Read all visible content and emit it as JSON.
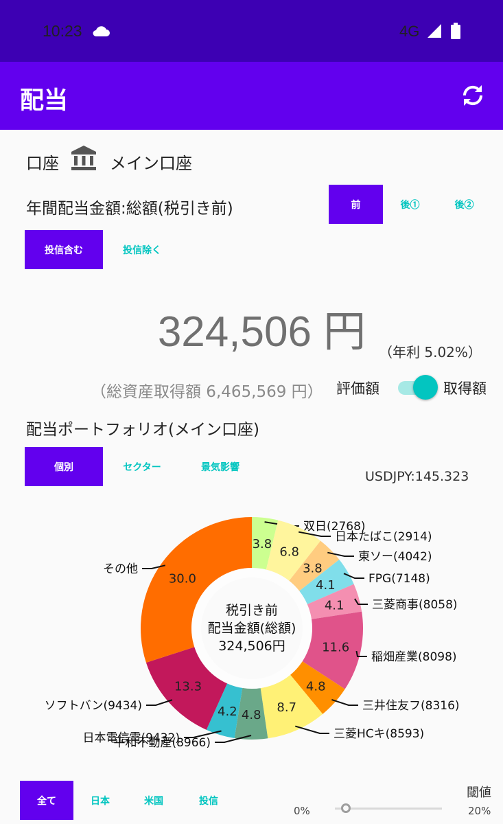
{
  "status_bar": {
    "time": "10:23",
    "network": "4G"
  },
  "app_bar": {
    "title": "配当"
  },
  "account": {
    "label": "口座",
    "name": "メイン口座"
  },
  "annual": {
    "title": "年間配当金額:総額(税引き前)",
    "tax_tabs": [
      "前",
      "後①",
      "後②"
    ],
    "fund_tabs": [
      "投信含む",
      "投信除く"
    ]
  },
  "summary": {
    "total": "324,506 円",
    "yield": "（年利 5.02%）",
    "acquisition": "（総資産取得額 6,465,569 円）",
    "toggle_left": "評価額",
    "toggle_right": "取得額",
    "toggle_on": true
  },
  "portfolio": {
    "title": "配当ポートフォリオ(メイン口座)",
    "tabs": [
      "個別",
      "セクター",
      "景気影響"
    ],
    "usdjpy": "USDJPY:145.323"
  },
  "chart_data": {
    "type": "pie",
    "center_text": [
      "税引き前",
      "配当金額(総額)",
      "324,506円"
    ],
    "slices": [
      {
        "label": "双日(2768)",
        "value": 3.8,
        "color": "#ccff90"
      },
      {
        "label": "日本たばこ(2914)",
        "value": 6.8,
        "color": "#fff59d"
      },
      {
        "label": "東ソー(4042)",
        "value": 3.8,
        "color": "#ffcc80"
      },
      {
        "label": "FPG(7148)",
        "value": 4.1,
        "color": "#80deea"
      },
      {
        "label": "三菱商事(8058)",
        "value": 4.1,
        "color": "#f48fb1"
      },
      {
        "label": "稲畑産業(8098)",
        "value": 11.6,
        "color": "#e0538a"
      },
      {
        "label": "三井住友フ(8316)",
        "value": 4.8,
        "color": "#ff8f00"
      },
      {
        "label": "三菱HCキ(8593)",
        "value": 8.7,
        "color": "#fff176"
      },
      {
        "label": "平和不動産(8966)",
        "value": 4.8,
        "color": "#6aa889"
      },
      {
        "label": "日本電信電(9432)",
        "value": 4.2,
        "color": "#36c0d0"
      },
      {
        "label": "ソフトバン(9434)",
        "value": 13.3,
        "color": "#c2185b"
      },
      {
        "label": "その他",
        "value": 30.0,
        "color": "#ff6d00"
      }
    ]
  },
  "filter": {
    "tabs": [
      "全て",
      "日本",
      "米国",
      "投信"
    ],
    "threshold_label": "閾値",
    "slider_min": "0%",
    "slider_max": "20%",
    "threshold_value": 0.1
  }
}
